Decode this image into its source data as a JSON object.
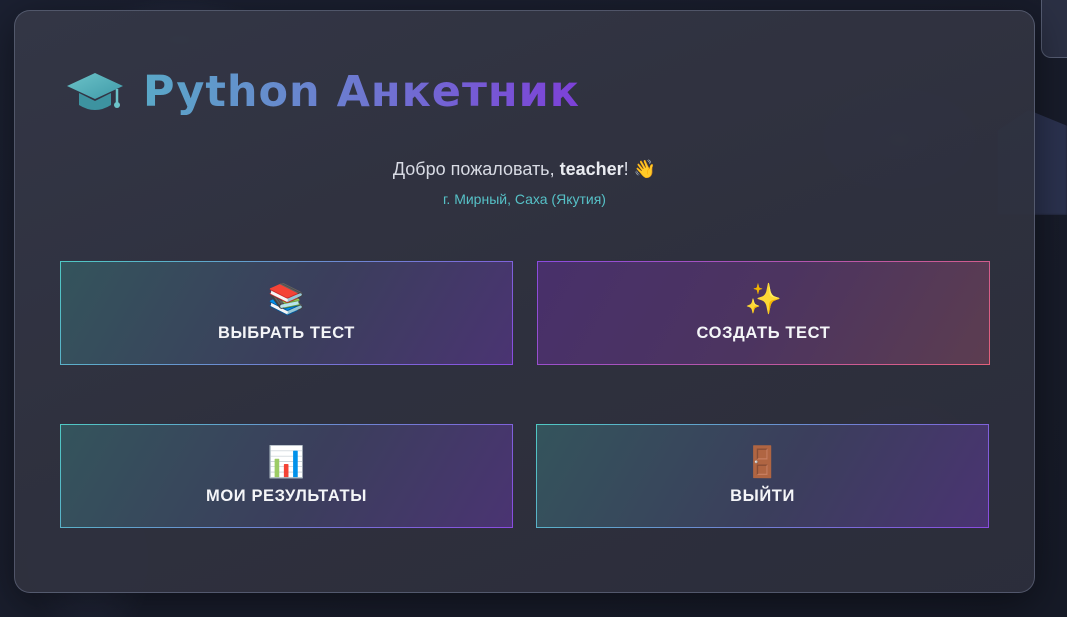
{
  "header": {
    "title": "Python Анкетник",
    "icon": "graduation-cap-icon",
    "accent_start": "#5aa8c8",
    "accent_end": "#7d40d8"
  },
  "welcome": {
    "greeting": "Добро пожаловать, ",
    "username": "teacher",
    "exclamation": "!",
    "emoji": "👋",
    "location": "г. Мирный, Саха (Якутия)"
  },
  "menu": {
    "select_test": {
      "label": "ВЫБРАТЬ ТЕСТ",
      "icon": "📚",
      "icon_name": "books-icon"
    },
    "create_test": {
      "label": "СОЗДАТЬ ТЕСТ",
      "icon": "✨",
      "icon_name": "sparkles-icon"
    },
    "my_results": {
      "label": "МОИ РЕЗУЛЬТАТЫ",
      "icon": "📊",
      "icon_name": "bar-chart-icon"
    },
    "logout": {
      "label": "ВЫЙТИ",
      "icon": "🚪",
      "icon_name": "door-icon"
    }
  },
  "colors": {
    "teal": "#4fc9c4",
    "purple": "#8a4be0",
    "pink": "#e2607a",
    "location_text": "#56c1c7"
  }
}
